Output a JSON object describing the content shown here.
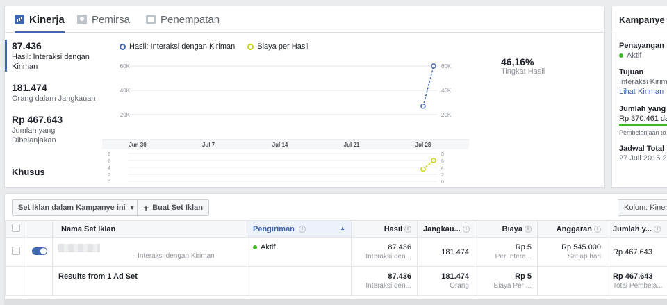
{
  "tabs": [
    {
      "label": "Kinerja",
      "icon": "bar-chart-icon",
      "active": true
    },
    {
      "label": "Pemirsa",
      "icon": "people-icon",
      "active": false
    },
    {
      "label": "Penempatan",
      "icon": "placement-icon",
      "active": false
    }
  ],
  "metrics": [
    {
      "value": "87.436",
      "label": "Hasil: Interaksi dengan Kiriman",
      "selected": true
    },
    {
      "value": "181.474",
      "label": "Orang dalam Jangkauan",
      "selected": false
    },
    {
      "value": "Rp 467.643",
      "label": "Jumlah yang Dibelanjakan",
      "selected": false
    }
  ],
  "khusus_label": "Khusus",
  "legend": {
    "series1": "Hasil: Interaksi dengan Kiriman",
    "series2": "Biaya per Hasil"
  },
  "summary_stat": {
    "value": "46,16%",
    "label": "Tingkat Hasil"
  },
  "chart_data": {
    "type": "line",
    "x_ticks": [
      "Jun 30",
      "Jul 7",
      "Jul 14",
      "Jul 21",
      "Jul 28"
    ],
    "main_y_ticks": [
      "60K",
      "40K",
      "20K"
    ],
    "sub_y_ticks": [
      "8",
      "6",
      "4",
      "2",
      "0"
    ],
    "series": [
      {
        "name": "Hasil: Interaksi dengan Kiriman",
        "color": "#4267b2",
        "x": [
          "Jul 28",
          "Jul 29"
        ],
        "values": [
          27000,
          60000
        ]
      },
      {
        "name": "Biaya per Hasil",
        "color": "#c7d41a",
        "x": [
          "Jul 28",
          "Jul 29"
        ],
        "values": [
          3.5,
          6
        ]
      }
    ]
  },
  "campaign_panel": {
    "title": "Kampanye",
    "delivery_label": "Penayangan",
    "delivery_status": "Aktif",
    "objective_label": "Tujuan",
    "objective_value": "Interaksi Kirima",
    "objective_link": "Lihat Kiriman",
    "spent_label": "Jumlah yang D",
    "spent_value": "Rp 370.461 da",
    "spent_note": "Pembelanjaan to",
    "schedule_label": "Jadwal Total",
    "schedule_value": "27 Juli 2015 22"
  },
  "toolbar": {
    "adset_dropdown": "Set Iklan dalam Kampanye ini",
    "create_button": "Buat Set Iklan",
    "columns_button": "Kolom: Kiner"
  },
  "table": {
    "headers": [
      "Nama Set Iklan",
      "Pengiriman",
      "Hasil",
      "Jangkau...",
      "Biaya",
      "Anggaran",
      "Jumlah y..."
    ],
    "row": {
      "name_suffix": "- Interaksi dengan Kiriman",
      "delivery": "Aktif",
      "results": "87.436",
      "results_sub": "Interaksi den...",
      "reach": "181.474",
      "cost": "Rp 5",
      "cost_sub": "Per Intera...",
      "budget": "Rp 545.000",
      "budget_sub": "Setiap hari",
      "spent": "Rp 467.643"
    },
    "summary": {
      "label": "Results from 1 Ad Set",
      "results": "87.436",
      "results_sub": "Interaksi den...",
      "reach": "181.474",
      "reach_sub": "Orang",
      "cost": "Rp 5",
      "cost_sub": "Biaya Per ...",
      "spent": "Rp 467.643",
      "spent_sub": "Total Pembela..."
    }
  }
}
